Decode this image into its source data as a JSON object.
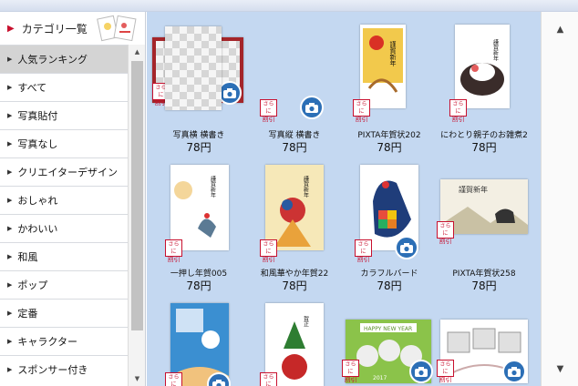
{
  "sidebar": {
    "header_label": "カテゴリ一覧",
    "categories": [
      {
        "label": "人気ランキング",
        "active": true
      },
      {
        "label": "すべて"
      },
      {
        "label": "写真貼付"
      },
      {
        "label": "写真なし"
      },
      {
        "label": "クリエイターデザイン"
      },
      {
        "label": "おしゃれ"
      },
      {
        "label": "かわいい"
      },
      {
        "label": "和風"
      },
      {
        "label": "ポップ"
      },
      {
        "label": "定番"
      },
      {
        "label": "キャラクター"
      },
      {
        "label": "スポンサー付き"
      }
    ]
  },
  "badge": {
    "line1": "さらに",
    "line2": "割引"
  },
  "colors": {
    "accent": "#c8102e",
    "camera": "#2c6fb6",
    "grid_bg": "#c4d8f1",
    "selected_border": "#a4252a"
  },
  "icons": {
    "camera": "camera-icon",
    "up": "chevron-up-icon",
    "down": "chevron-down-icon"
  },
  "cards": [
    {
      "title": "写真横 横書き",
      "price": "78円"
    },
    {
      "title": "写真縦 横書き",
      "price": "78円"
    },
    {
      "title": "PIXTA年賀状202",
      "price": "78円"
    },
    {
      "title": "にわとり親子のお雑煮2",
      "price": "78円"
    },
    {
      "title": "一押し年賀005",
      "price": "78円"
    },
    {
      "title": "和風華やか年賀22",
      "price": "78円"
    },
    {
      "title": "カラフルバード",
      "price": "78円"
    },
    {
      "title": "PIXTA年賀状258",
      "price": "78円"
    },
    {
      "title": "",
      "price": ""
    },
    {
      "title": "",
      "price": ""
    },
    {
      "title": "",
      "price": ""
    },
    {
      "title": "",
      "price": ""
    }
  ],
  "card_art": {
    "kinga": "謹賀新年",
    "fukuwarai": "賀正",
    "happy_new_year": "HAPPY NEW YEAR",
    "year": "2017"
  }
}
